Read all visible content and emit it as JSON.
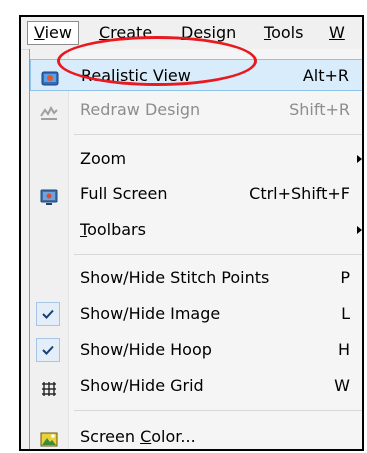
{
  "menubar": {
    "items": [
      {
        "label": "View",
        "mnemonic": "V",
        "rest": "iew",
        "active": true
      },
      {
        "label": "Create",
        "mnemonic": "C",
        "rest": "reate"
      },
      {
        "label": "Design",
        "mnemonic": "D",
        "rest": "esign"
      },
      {
        "label": "Tools",
        "mnemonic": "T",
        "rest": "ools"
      },
      {
        "label": "W",
        "mnemonic": "W",
        "rest": ""
      }
    ]
  },
  "menu": {
    "realistic_view": {
      "label": "Realistic View",
      "shortcut": "Alt+R"
    },
    "redraw_design": {
      "label": "Redraw Design",
      "shortcut": "Shift+R"
    },
    "zoom": {
      "label": "Zoom"
    },
    "full_screen": {
      "label": "Full Screen",
      "shortcut": "Ctrl+Shift+F"
    },
    "toolbars": {
      "mnemonic": "T",
      "rest": "oolbars"
    },
    "stitch_points": {
      "label": "Show/Hide Stitch Points",
      "shortcut": "P"
    },
    "image": {
      "label": "Show/Hide Image",
      "shortcut": "L",
      "checked": true
    },
    "hoop": {
      "label": "Show/Hide Hoop",
      "shortcut": "H",
      "checked": true
    },
    "grid": {
      "label": "Show/Hide Grid",
      "shortcut": "W"
    },
    "screen_color": {
      "before": "Screen ",
      "mnemonic": "C",
      "after": "olor..."
    }
  },
  "colors": {
    "highlight": "#d9ecfb",
    "annotation_red": "#e8191f",
    "disabled_text": "#8d8d8d"
  }
}
